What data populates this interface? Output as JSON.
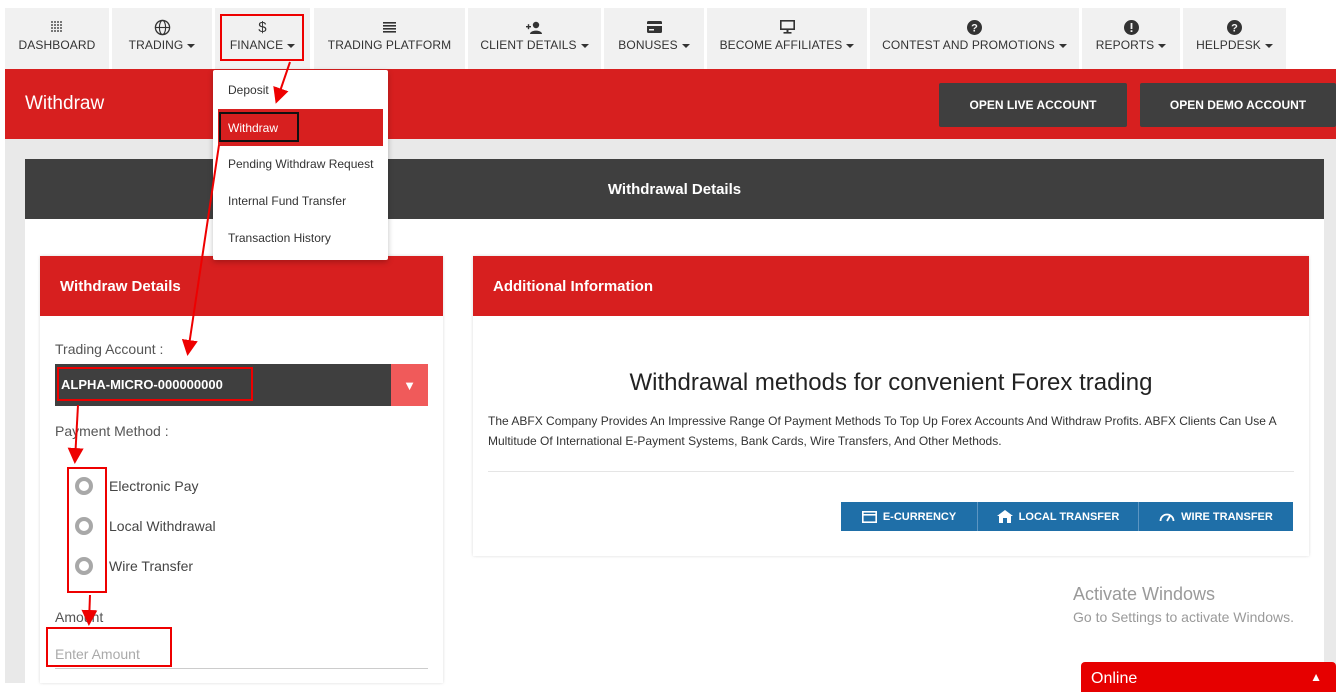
{
  "nav": {
    "items": [
      {
        "label": "DASHBOARD",
        "icon": "dashboard-grid-icon",
        "caret": false
      },
      {
        "label": "TRADING",
        "icon": "globe-icon",
        "caret": true
      },
      {
        "label": "FINANCE",
        "icon": "dollar-icon",
        "caret": true
      },
      {
        "label": "TRADING PLATFORM",
        "icon": "list-icon",
        "caret": false
      },
      {
        "label": "CLIENT DETAILS",
        "icon": "user-plus-icon",
        "caret": true
      },
      {
        "label": "BONUSES",
        "icon": "card-icon",
        "caret": true
      },
      {
        "label": "BECOME AFFILIATES",
        "icon": "monitor-icon",
        "caret": true
      },
      {
        "label": "CONTEST AND PROMOTIONS",
        "icon": "question-icon",
        "caret": true
      },
      {
        "label": "REPORTS",
        "icon": "alert-icon",
        "caret": true
      },
      {
        "label": "HELPDESK",
        "icon": "question-icon",
        "caret": true
      }
    ],
    "dollar_glyph": "$"
  },
  "finance_menu": {
    "items": [
      "Deposit",
      "Withdraw",
      "Pending Withdraw Request",
      "Internal Fund Transfer",
      "Transaction History"
    ],
    "active": "Withdraw"
  },
  "header": {
    "title": "Withdraw",
    "open_live_label": "OPEN LIVE ACCOUNT",
    "open_demo_label": "OPEN DEMO ACCOUNT"
  },
  "card": {
    "title": "Withdrawal Details"
  },
  "withdraw_form": {
    "title": "Withdraw Details",
    "trading_account_label": "Trading Account :",
    "trading_account_value": "ALPHA-MICRO-000000000",
    "payment_method_label": "Payment Method :",
    "payment_methods": [
      "Electronic Pay",
      "Local Withdrawal",
      "Wire Transfer"
    ],
    "amount_label": "Amount",
    "amount_placeholder": "Enter Amount"
  },
  "additional_info": {
    "title": "Additional Information",
    "heading": "Withdrawal methods for convenient Forex trading",
    "description": "The ABFX Company Provides An Impressive Range Of Payment Methods To Top Up Forex Accounts And Withdraw Profits. ABFX Clients Can Use A Multitude Of International E-Payment Systems, Bank Cards, Wire Transfers, And Other Methods.",
    "methods": [
      {
        "label": "E-CURRENCY",
        "icon": "wallet-icon"
      },
      {
        "label": "LOCAL TRANSFER",
        "icon": "home-icon"
      },
      {
        "label": "WIRE TRANSFER",
        "icon": "speedometer-icon"
      }
    ]
  },
  "watermark": {
    "title": "Activate Windows",
    "subtitle": "Go to Settings to activate Windows."
  },
  "chat": {
    "label": "Online"
  },
  "colors": {
    "brand_red": "#d71f1f",
    "dark_gray": "#3f3f3f",
    "button_blue": "#1f6fa8",
    "annotation_red": "#e00000"
  }
}
